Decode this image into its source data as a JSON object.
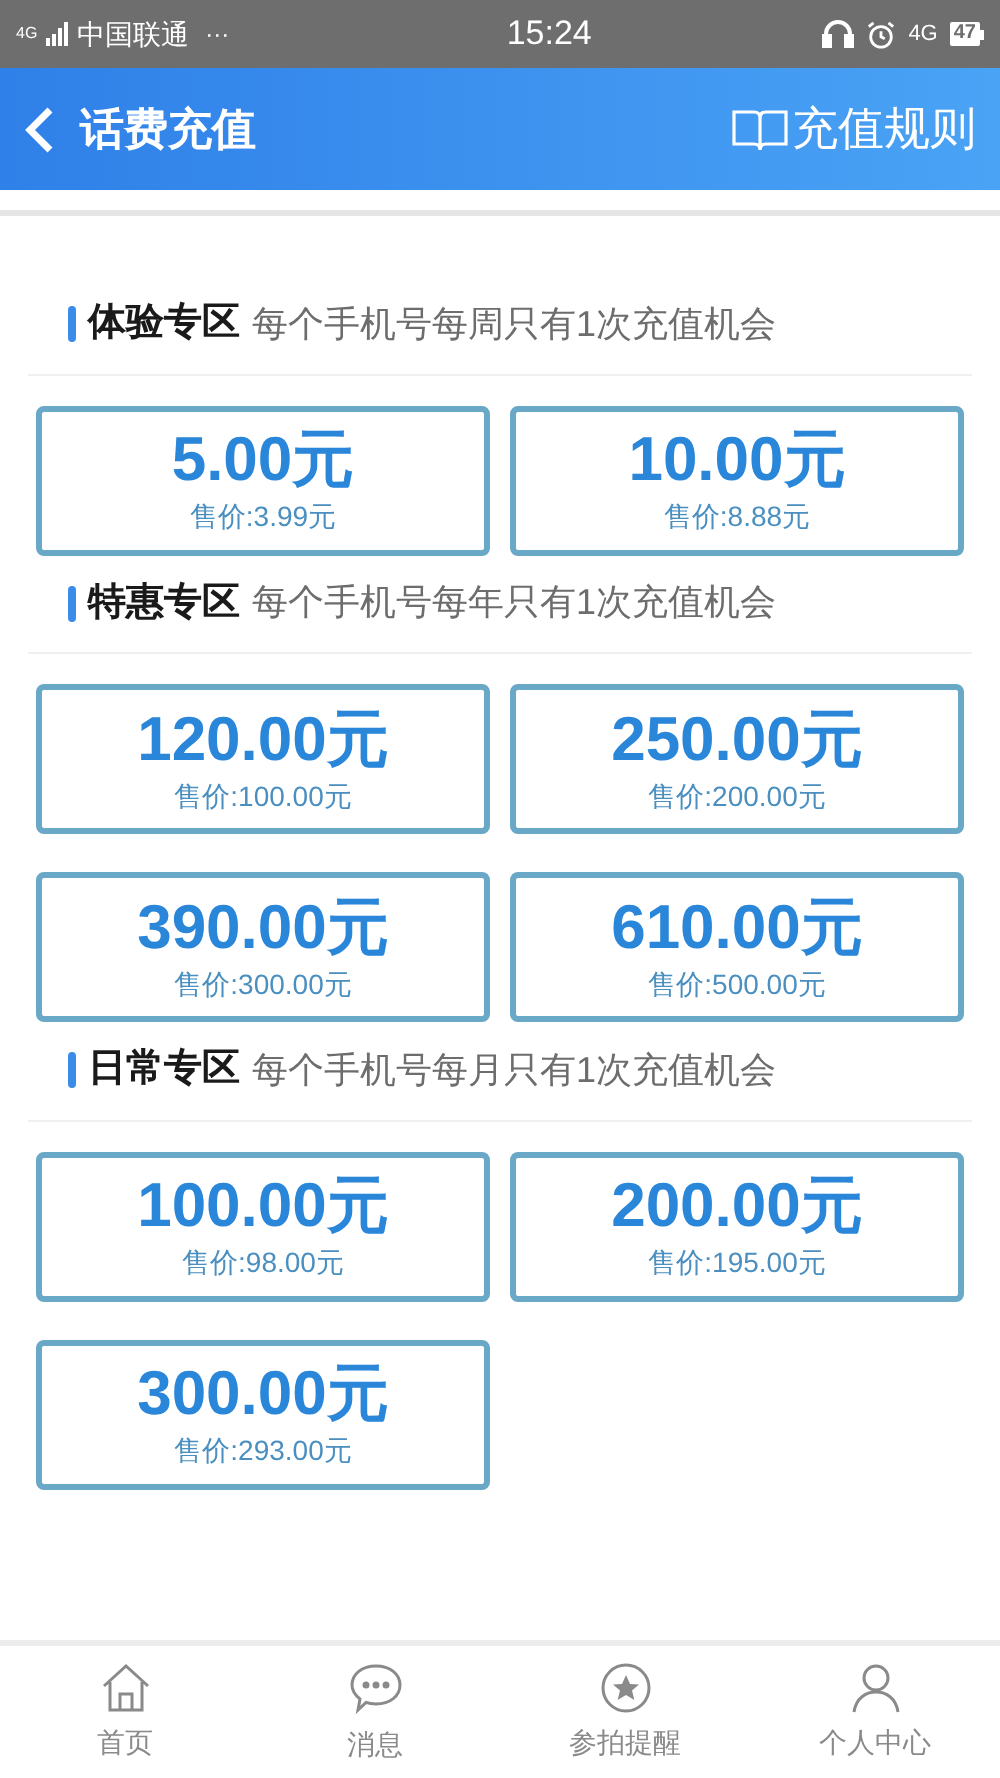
{
  "status_bar": {
    "signal_label": "4G",
    "carrier": "中国联通",
    "more": "···",
    "time": "15:24",
    "network": "4G",
    "battery": "47"
  },
  "header": {
    "title": "话费充值",
    "link": "充值规则"
  },
  "sections": [
    {
      "title": "体验专区",
      "note": "每个手机号每周只有1次充值机会",
      "options": [
        {
          "amount": "5.00元",
          "price": "售价:3.99元"
        },
        {
          "amount": "10.00元",
          "price": "售价:8.88元"
        }
      ]
    },
    {
      "title": "特惠专区",
      "note": "每个手机号每年只有1次充值机会",
      "options": [
        {
          "amount": "120.00元",
          "price": "售价:100.00元"
        },
        {
          "amount": "250.00元",
          "price": "售价:200.00元"
        },
        {
          "amount": "390.00元",
          "price": "售价:300.00元"
        },
        {
          "amount": "610.00元",
          "price": "售价:500.00元"
        }
      ]
    },
    {
      "title": "日常专区",
      "note": "每个手机号每月只有1次充值机会",
      "options": [
        {
          "amount": "100.00元",
          "price": "售价:98.00元"
        },
        {
          "amount": "200.00元",
          "price": "售价:195.00元"
        },
        {
          "amount": "300.00元",
          "price": "售价:293.00元"
        }
      ]
    }
  ],
  "nav": [
    {
      "kind": "home",
      "label": "首页"
    },
    {
      "kind": "message",
      "label": "消息"
    },
    {
      "kind": "star",
      "label": "参拍提醒"
    },
    {
      "kind": "user",
      "label": "个人中心"
    }
  ]
}
